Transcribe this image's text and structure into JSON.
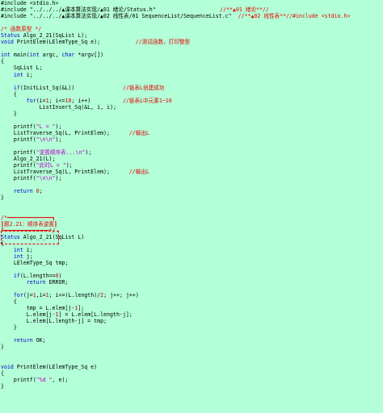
{
  "code": {
    "lines": [
      [
        [
          "preproc",
          "#include <stdio.h>"
        ]
      ],
      [
        [
          "preproc",
          "#include \"../../../▲课本算法实现/▲01 绪论/Status.h\"                    "
        ],
        [
          "comment",
          "//**▲01 绪论**//"
        ]
      ],
      [
        [
          "preproc",
          "#include \"../../../▲课本算法实现/▲02 线性表/01 SequenceList/SequenceList.c\"  "
        ],
        [
          "comment",
          "//**▲02 线性表**//#include <stdio.h>"
        ]
      ],
      [
        [
          "plain",
          ""
        ]
      ],
      [
        [
          "comment",
          "/* 函数原型 */"
        ]
      ],
      [
        [
          "type",
          "Status"
        ],
        [
          "plain",
          " Algo_2_21(SqList L);"
        ]
      ],
      [
        [
          "type",
          "void"
        ],
        [
          "plain",
          " PrintElem(LElemType_Sq e);           "
        ],
        [
          "comment",
          "//测试函数，打印整型"
        ]
      ],
      [
        [
          "plain",
          ""
        ]
      ],
      [
        [
          "type",
          "int"
        ],
        [
          "plain",
          " main("
        ],
        [
          "type",
          "int"
        ],
        [
          "plain",
          " argc, "
        ],
        [
          "type",
          "char"
        ],
        [
          "plain",
          " *argv[])"
        ]
      ],
      [
        [
          "plain",
          "{"
        ]
      ],
      [
        [
          "plain",
          "    SqList L;"
        ]
      ],
      [
        [
          "plain",
          "    "
        ],
        [
          "type",
          "int"
        ],
        [
          "plain",
          " i;"
        ]
      ],
      [
        [
          "plain",
          ""
        ]
      ],
      [
        [
          "plain",
          "    "
        ],
        [
          "kw",
          "if"
        ],
        [
          "plain",
          "(InitList_Sq(&L))               "
        ],
        [
          "comment",
          "//链表L创建成功"
        ]
      ],
      [
        [
          "plain",
          "    {"
        ]
      ],
      [
        [
          "plain",
          "        "
        ],
        [
          "kw",
          "for"
        ],
        [
          "plain",
          "(i="
        ],
        [
          "num",
          "1"
        ],
        [
          "plain",
          "; i<="
        ],
        [
          "num",
          "10"
        ],
        [
          "plain",
          "; i++)          "
        ],
        [
          "comment",
          "//链表L中元素1~10"
        ]
      ],
      [
        [
          "plain",
          "            ListInsert_Sq(&L, i, i);"
        ]
      ],
      [
        [
          "plain",
          "    }"
        ]
      ],
      [
        [
          "plain",
          ""
        ]
      ],
      [
        [
          "plain",
          "    printf("
        ],
        [
          "str",
          "\"L = \""
        ],
        [
          "plain",
          ");"
        ]
      ],
      [
        [
          "plain",
          "    ListTraverse_Sq(L, PrintElem);      "
        ],
        [
          "comment",
          "//输出L"
        ]
      ],
      [
        [
          "plain",
          "    printf("
        ],
        [
          "str",
          "\"\\n\\n\""
        ],
        [
          "plain",
          ");"
        ]
      ],
      [
        [
          "plain",
          ""
        ]
      ],
      [
        [
          "plain",
          "    printf("
        ],
        [
          "str",
          "\"逆置顺序表...\\n\""
        ],
        [
          "plain",
          ");"
        ]
      ],
      [
        [
          "plain",
          "    Algo_2_21(L);"
        ]
      ],
      [
        [
          "plain",
          "    printf("
        ],
        [
          "str",
          "\"此时L = \""
        ],
        [
          "plain",
          ");"
        ]
      ],
      [
        [
          "plain",
          "    ListTraverse_Sq(L, PrintElem);      "
        ],
        [
          "comment",
          "//输出L"
        ]
      ],
      [
        [
          "plain",
          "    printf("
        ],
        [
          "str",
          "\"\\n\\n\""
        ],
        [
          "plain",
          ");"
        ]
      ],
      [
        [
          "plain",
          ""
        ]
      ],
      [
        [
          "plain",
          "    "
        ],
        [
          "kw",
          "return"
        ],
        [
          "plain",
          " "
        ],
        [
          "num",
          "0"
        ],
        [
          "plain",
          ";"
        ]
      ],
      [
        [
          "plain",
          "}"
        ]
      ],
      [
        [
          "plain",
          ""
        ]
      ],
      [
        [
          "plain",
          ""
        ]
      ],
      [
        [
          "comment",
          "/*━━━━━━━━━━━━━━┓"
        ]
      ],
      [
        [
          "comment",
          "┃题2.21：顺序表逆置┃"
        ]
      ],
      [
        [
          "comment",
          "┗━━━━━━━━━━━━━━*/"
        ]
      ],
      [
        [
          "type",
          "Status"
        ],
        [
          "plain",
          " Algo_2_21(SqList L)"
        ]
      ],
      [
        [
          "plain",
          "{"
        ]
      ],
      [
        [
          "plain",
          "    "
        ],
        [
          "type",
          "int"
        ],
        [
          "plain",
          " i;"
        ]
      ],
      [
        [
          "plain",
          "    "
        ],
        [
          "type",
          "int"
        ],
        [
          "plain",
          " j;"
        ]
      ],
      [
        [
          "plain",
          "    LElemType_Sq tmp;"
        ]
      ],
      [
        [
          "plain",
          ""
        ]
      ],
      [
        [
          "plain",
          "    "
        ],
        [
          "kw",
          "if"
        ],
        [
          "plain",
          "(L.length=="
        ],
        [
          "num",
          "0"
        ],
        [
          "plain",
          ")"
        ]
      ],
      [
        [
          "plain",
          "        "
        ],
        [
          "kw",
          "return"
        ],
        [
          "plain",
          " ERROR;"
        ]
      ],
      [
        [
          "plain",
          ""
        ]
      ],
      [
        [
          "plain",
          "    "
        ],
        [
          "kw",
          "for"
        ],
        [
          "plain",
          "(j="
        ],
        [
          "num",
          "1"
        ],
        [
          "plain",
          ",i="
        ],
        [
          "num",
          "1"
        ],
        [
          "plain",
          "; i<=(L.length)/"
        ],
        [
          "num",
          "2"
        ],
        [
          "plain",
          "; j++; j++)"
        ]
      ],
      [
        [
          "plain",
          "    {"
        ]
      ],
      [
        [
          "plain",
          "        tmp = L.elem[j-"
        ],
        [
          "num",
          "1"
        ],
        [
          "plain",
          "];"
        ]
      ],
      [
        [
          "plain",
          "        L.elem[j-"
        ],
        [
          "num",
          "1"
        ],
        [
          "plain",
          "] = L.elem[L.length-j];"
        ]
      ],
      [
        [
          "plain",
          "        L.elem[L.length-j] = tmp;"
        ]
      ],
      [
        [
          "plain",
          "    }"
        ]
      ],
      [
        [
          "plain",
          ""
        ]
      ],
      [
        [
          "plain",
          "    "
        ],
        [
          "kw",
          "return"
        ],
        [
          "plain",
          " OK;"
        ]
      ],
      [
        [
          "plain",
          "}"
        ]
      ],
      [
        [
          "plain",
          ""
        ]
      ],
      [
        [
          "plain",
          ""
        ]
      ],
      [
        [
          "type",
          "void"
        ],
        [
          "plain",
          " PrintElem(LElemType_Sq e)"
        ]
      ],
      [
        [
          "plain",
          "{"
        ]
      ],
      [
        [
          "plain",
          "    printf("
        ],
        [
          "str",
          "\"%d \""
        ],
        [
          "plain",
          ", e);"
        ]
      ],
      [
        [
          "plain",
          "}"
        ]
      ]
    ]
  }
}
